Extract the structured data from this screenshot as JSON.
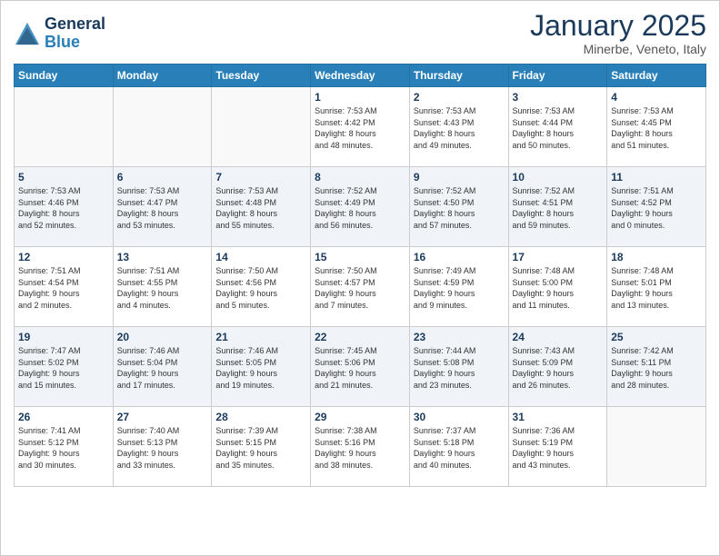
{
  "logo": {
    "line1": "General",
    "line2": "Blue"
  },
  "title": "January 2025",
  "location": "Minerbe, Veneto, Italy",
  "weekdays": [
    "Sunday",
    "Monday",
    "Tuesday",
    "Wednesday",
    "Thursday",
    "Friday",
    "Saturday"
  ],
  "weeks": [
    [
      {
        "day": "",
        "info": ""
      },
      {
        "day": "",
        "info": ""
      },
      {
        "day": "",
        "info": ""
      },
      {
        "day": "1",
        "info": "Sunrise: 7:53 AM\nSunset: 4:42 PM\nDaylight: 8 hours\nand 48 minutes."
      },
      {
        "day": "2",
        "info": "Sunrise: 7:53 AM\nSunset: 4:43 PM\nDaylight: 8 hours\nand 49 minutes."
      },
      {
        "day": "3",
        "info": "Sunrise: 7:53 AM\nSunset: 4:44 PM\nDaylight: 8 hours\nand 50 minutes."
      },
      {
        "day": "4",
        "info": "Sunrise: 7:53 AM\nSunset: 4:45 PM\nDaylight: 8 hours\nand 51 minutes."
      }
    ],
    [
      {
        "day": "5",
        "info": "Sunrise: 7:53 AM\nSunset: 4:46 PM\nDaylight: 8 hours\nand 52 minutes."
      },
      {
        "day": "6",
        "info": "Sunrise: 7:53 AM\nSunset: 4:47 PM\nDaylight: 8 hours\nand 53 minutes."
      },
      {
        "day": "7",
        "info": "Sunrise: 7:53 AM\nSunset: 4:48 PM\nDaylight: 8 hours\nand 55 minutes."
      },
      {
        "day": "8",
        "info": "Sunrise: 7:52 AM\nSunset: 4:49 PM\nDaylight: 8 hours\nand 56 minutes."
      },
      {
        "day": "9",
        "info": "Sunrise: 7:52 AM\nSunset: 4:50 PM\nDaylight: 8 hours\nand 57 minutes."
      },
      {
        "day": "10",
        "info": "Sunrise: 7:52 AM\nSunset: 4:51 PM\nDaylight: 8 hours\nand 59 minutes."
      },
      {
        "day": "11",
        "info": "Sunrise: 7:51 AM\nSunset: 4:52 PM\nDaylight: 9 hours\nand 0 minutes."
      }
    ],
    [
      {
        "day": "12",
        "info": "Sunrise: 7:51 AM\nSunset: 4:54 PM\nDaylight: 9 hours\nand 2 minutes."
      },
      {
        "day": "13",
        "info": "Sunrise: 7:51 AM\nSunset: 4:55 PM\nDaylight: 9 hours\nand 4 minutes."
      },
      {
        "day": "14",
        "info": "Sunrise: 7:50 AM\nSunset: 4:56 PM\nDaylight: 9 hours\nand 5 minutes."
      },
      {
        "day": "15",
        "info": "Sunrise: 7:50 AM\nSunset: 4:57 PM\nDaylight: 9 hours\nand 7 minutes."
      },
      {
        "day": "16",
        "info": "Sunrise: 7:49 AM\nSunset: 4:59 PM\nDaylight: 9 hours\nand 9 minutes."
      },
      {
        "day": "17",
        "info": "Sunrise: 7:48 AM\nSunset: 5:00 PM\nDaylight: 9 hours\nand 11 minutes."
      },
      {
        "day": "18",
        "info": "Sunrise: 7:48 AM\nSunset: 5:01 PM\nDaylight: 9 hours\nand 13 minutes."
      }
    ],
    [
      {
        "day": "19",
        "info": "Sunrise: 7:47 AM\nSunset: 5:02 PM\nDaylight: 9 hours\nand 15 minutes."
      },
      {
        "day": "20",
        "info": "Sunrise: 7:46 AM\nSunset: 5:04 PM\nDaylight: 9 hours\nand 17 minutes."
      },
      {
        "day": "21",
        "info": "Sunrise: 7:46 AM\nSunset: 5:05 PM\nDaylight: 9 hours\nand 19 minutes."
      },
      {
        "day": "22",
        "info": "Sunrise: 7:45 AM\nSunset: 5:06 PM\nDaylight: 9 hours\nand 21 minutes."
      },
      {
        "day": "23",
        "info": "Sunrise: 7:44 AM\nSunset: 5:08 PM\nDaylight: 9 hours\nand 23 minutes."
      },
      {
        "day": "24",
        "info": "Sunrise: 7:43 AM\nSunset: 5:09 PM\nDaylight: 9 hours\nand 26 minutes."
      },
      {
        "day": "25",
        "info": "Sunrise: 7:42 AM\nSunset: 5:11 PM\nDaylight: 9 hours\nand 28 minutes."
      }
    ],
    [
      {
        "day": "26",
        "info": "Sunrise: 7:41 AM\nSunset: 5:12 PM\nDaylight: 9 hours\nand 30 minutes."
      },
      {
        "day": "27",
        "info": "Sunrise: 7:40 AM\nSunset: 5:13 PM\nDaylight: 9 hours\nand 33 minutes."
      },
      {
        "day": "28",
        "info": "Sunrise: 7:39 AM\nSunset: 5:15 PM\nDaylight: 9 hours\nand 35 minutes."
      },
      {
        "day": "29",
        "info": "Sunrise: 7:38 AM\nSunset: 5:16 PM\nDaylight: 9 hours\nand 38 minutes."
      },
      {
        "day": "30",
        "info": "Sunrise: 7:37 AM\nSunset: 5:18 PM\nDaylight: 9 hours\nand 40 minutes."
      },
      {
        "day": "31",
        "info": "Sunrise: 7:36 AM\nSunset: 5:19 PM\nDaylight: 9 hours\nand 43 minutes."
      },
      {
        "day": "",
        "info": ""
      }
    ]
  ]
}
